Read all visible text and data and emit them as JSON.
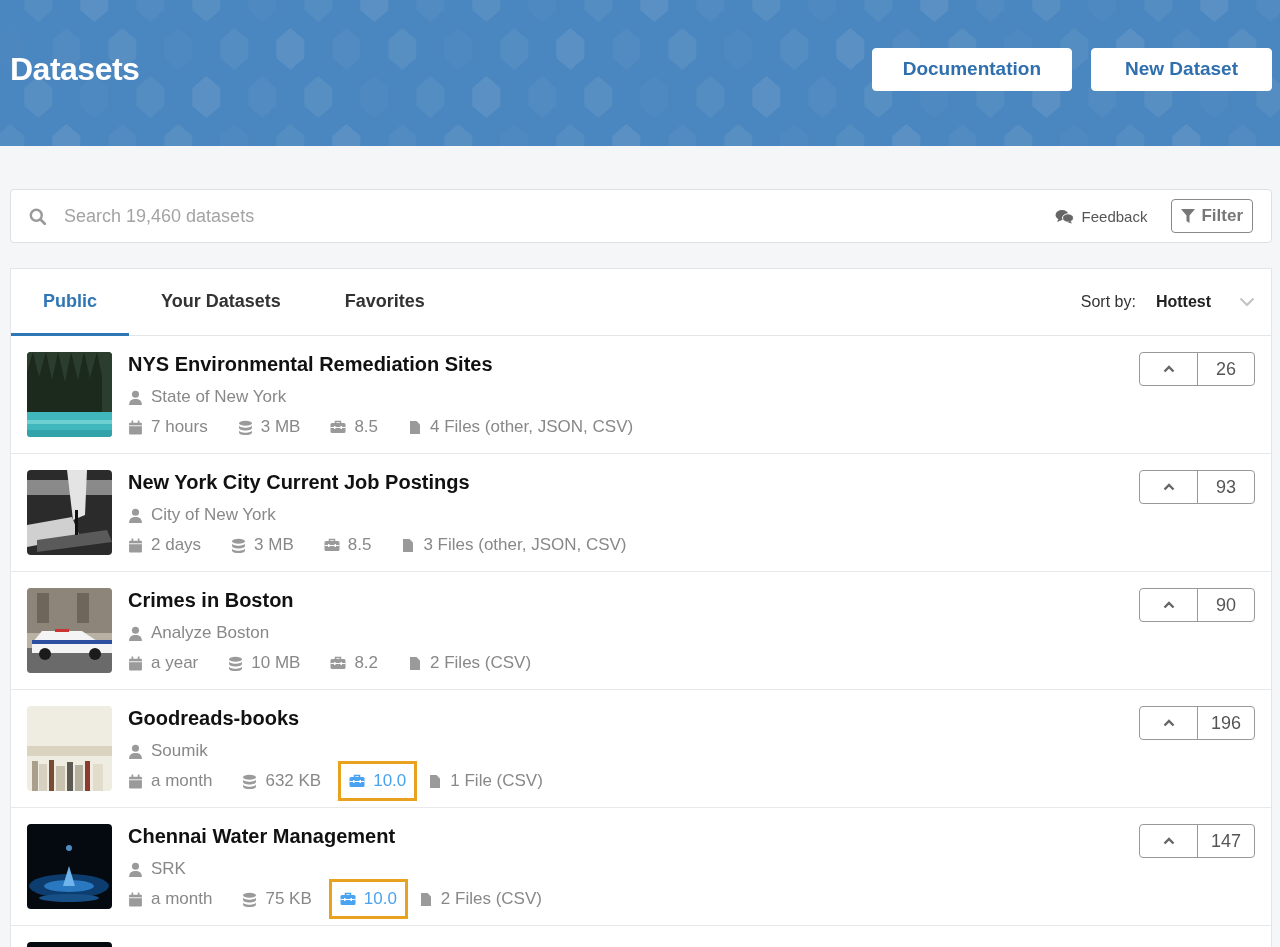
{
  "header": {
    "title": "Datasets",
    "buttons": [
      "Documentation",
      "New Dataset"
    ]
  },
  "search": {
    "placeholder": "Search 19,460 datasets",
    "feedback": "Feedback",
    "filter": "Filter"
  },
  "tabs": [
    {
      "label": "Public",
      "selected": true
    },
    {
      "label": "Your Datasets",
      "selected": false
    },
    {
      "label": "Favorites",
      "selected": false
    }
  ],
  "sort": {
    "label": "Sort by:",
    "value": "Hottest"
  },
  "datasets": [
    {
      "title": "NYS Environmental Remediation Sites",
      "owner": "State of New York",
      "updated": "7 hours",
      "size": "3 MB",
      "usability": "8.5",
      "highlighted": false,
      "files": "4 Files (other, JSON, CSV)",
      "votes": "26"
    },
    {
      "title": "New York City Current Job Postings",
      "owner": "City of New York",
      "updated": "2 days",
      "size": "3 MB",
      "usability": "8.5",
      "highlighted": false,
      "files": "3 Files (other, JSON, CSV)",
      "votes": "93"
    },
    {
      "title": "Crimes in Boston",
      "owner": "Analyze Boston",
      "updated": "a year",
      "size": "10 MB",
      "usability": "8.2",
      "highlighted": false,
      "files": "2 Files (CSV)",
      "votes": "90"
    },
    {
      "title": "Goodreads-books",
      "owner": "Soumik",
      "updated": "a month",
      "size": "632 KB",
      "usability": "10.0",
      "highlighted": true,
      "files": "1 File (CSV)",
      "votes": "196"
    },
    {
      "title": "Chennai Water Management",
      "owner": "SRK",
      "updated": "a month",
      "size": "75 KB",
      "usability": "10.0",
      "highlighted": true,
      "files": "2 Files (CSV)",
      "votes": "147"
    }
  ]
}
